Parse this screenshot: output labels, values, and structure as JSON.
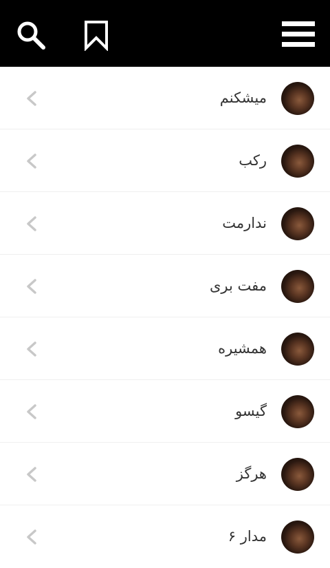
{
  "header": {
    "search_icon": "search-icon",
    "bookmark_icon": "bookmark-icon",
    "menu_icon": "hamburger-menu-icon"
  },
  "list": {
    "items": [
      {
        "title": "میشکنم"
      },
      {
        "title": "رکب"
      },
      {
        "title": "ندارمت"
      },
      {
        "title": "مفت بری"
      },
      {
        "title": "همشیره"
      },
      {
        "title": "گیسو"
      },
      {
        "title": "هرگز"
      },
      {
        "title": "مدار ۶"
      }
    ]
  },
  "colors": {
    "header_bg": "#000000",
    "text": "#333333",
    "chevron": "#c8c8c8",
    "divider": "#efefef"
  }
}
